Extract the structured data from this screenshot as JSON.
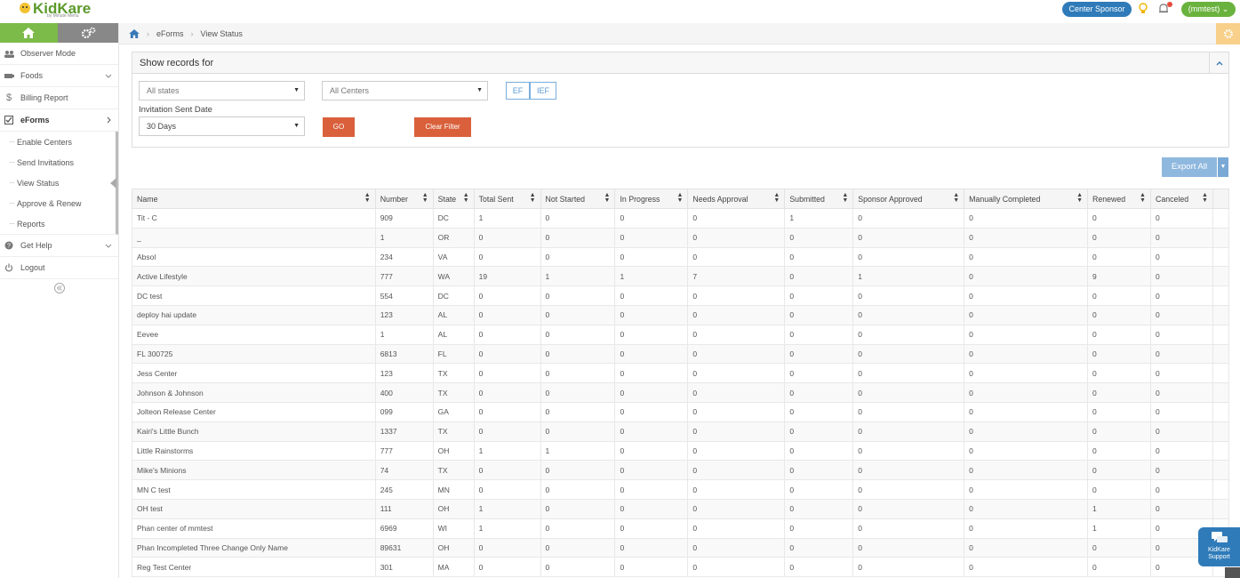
{
  "header": {
    "logo_text": "KidKare",
    "logo_sub": "by Minute Menu",
    "role_button": "Center Sponsor",
    "user_button": "(mmtest)"
  },
  "breadcrumb": [
    "eForms",
    "View Status"
  ],
  "sidebar": {
    "items": [
      {
        "label": "Observer Mode",
        "icon": "observer-icon"
      },
      {
        "label": "Foods",
        "icon": "foods-icon"
      },
      {
        "label": "Billing Report",
        "icon": "dollar-icon"
      },
      {
        "label": "eForms",
        "icon": "checkbox-icon"
      },
      {
        "label": "Get Help",
        "icon": "help-icon"
      },
      {
        "label": "Logout",
        "icon": "power-icon"
      }
    ],
    "subitems": [
      "Enable Centers",
      "Send Invitations",
      "View Status",
      "Approve & Renew",
      "Reports"
    ]
  },
  "filters": {
    "panel_title": "Show records for",
    "state_select": "All states",
    "center_select": "All Centers",
    "toggle_ef": "EF",
    "toggle_ief": "IEF",
    "date_label": "Invitation Sent Date",
    "date_select": "30 Days",
    "go_button": "GO",
    "clear_button": "Clear Filter"
  },
  "export": {
    "label": "Export All"
  },
  "table": {
    "columns": [
      "Name",
      "Number",
      "State",
      "Total Sent",
      "Not Started",
      "In Progress",
      "Needs Approval",
      "Submitted",
      "Sponsor Approved",
      "Manually Completed",
      "Renewed",
      "Canceled"
    ],
    "rows": [
      [
        "Tit - C",
        "909",
        "DC",
        "1",
        "0",
        "0",
        "0",
        "1",
        "0",
        "0",
        "0",
        "0"
      ],
      [
        "_",
        "1",
        "OR",
        "0",
        "0",
        "0",
        "0",
        "0",
        "0",
        "0",
        "0",
        "0"
      ],
      [
        "Absol",
        "234",
        "VA",
        "0",
        "0",
        "0",
        "0",
        "0",
        "0",
        "0",
        "0",
        "0"
      ],
      [
        "Active Lifestyle",
        "777",
        "WA",
        "19",
        "1",
        "1",
        "7",
        "0",
        "1",
        "0",
        "9",
        "0"
      ],
      [
        "DC test",
        "554",
        "DC",
        "0",
        "0",
        "0",
        "0",
        "0",
        "0",
        "0",
        "0",
        "0"
      ],
      [
        "deploy hai update",
        "123",
        "AL",
        "0",
        "0",
        "0",
        "0",
        "0",
        "0",
        "0",
        "0",
        "0"
      ],
      [
        "Eevee",
        "1",
        "AL",
        "0",
        "0",
        "0",
        "0",
        "0",
        "0",
        "0",
        "0",
        "0"
      ],
      [
        "FL 300725",
        "6813",
        "FL",
        "0",
        "0",
        "0",
        "0",
        "0",
        "0",
        "0",
        "0",
        "0"
      ],
      [
        "Jess Center",
        "123",
        "TX",
        "0",
        "0",
        "0",
        "0",
        "0",
        "0",
        "0",
        "0",
        "0"
      ],
      [
        "Johnson & Johnson",
        "400",
        "TX",
        "0",
        "0",
        "0",
        "0",
        "0",
        "0",
        "0",
        "0",
        "0"
      ],
      [
        "Jolteon Release Center",
        "099",
        "GA",
        "0",
        "0",
        "0",
        "0",
        "0",
        "0",
        "0",
        "0",
        "0"
      ],
      [
        "Kairi's Little Bunch",
        "1337",
        "TX",
        "0",
        "0",
        "0",
        "0",
        "0",
        "0",
        "0",
        "0",
        "0"
      ],
      [
        "Little Rainstorms",
        "777",
        "OH",
        "1",
        "1",
        "0",
        "0",
        "0",
        "0",
        "0",
        "0",
        "0"
      ],
      [
        "Mike's Minions",
        "74",
        "TX",
        "0",
        "0",
        "0",
        "0",
        "0",
        "0",
        "0",
        "0",
        "0"
      ],
      [
        "MN C test",
        "245",
        "MN",
        "0",
        "0",
        "0",
        "0",
        "0",
        "0",
        "0",
        "0",
        "0"
      ],
      [
        "OH test",
        "111",
        "OH",
        "1",
        "0",
        "0",
        "0",
        "0",
        "0",
        "0",
        "1",
        "0"
      ],
      [
        "Phan center of mmtest",
        "6969",
        "WI",
        "1",
        "0",
        "0",
        "0",
        "0",
        "0",
        "0",
        "1",
        "0"
      ],
      [
        "Phan Incompleted Three Change Only Name",
        "89631",
        "OH",
        "0",
        "0",
        "0",
        "0",
        "0",
        "0",
        "0",
        "0",
        "0"
      ],
      [
        "Reg Test Center",
        "301",
        "MA",
        "0",
        "0",
        "0",
        "0",
        "0",
        "0",
        "0",
        "0",
        "0"
      ]
    ]
  },
  "support": {
    "line1": "KidKare",
    "line2": "Support"
  },
  "colors": {
    "green": "#7cbb4a",
    "blue": "#2f7bb9",
    "link": "#3a79b8",
    "orange": "#d9603b"
  }
}
